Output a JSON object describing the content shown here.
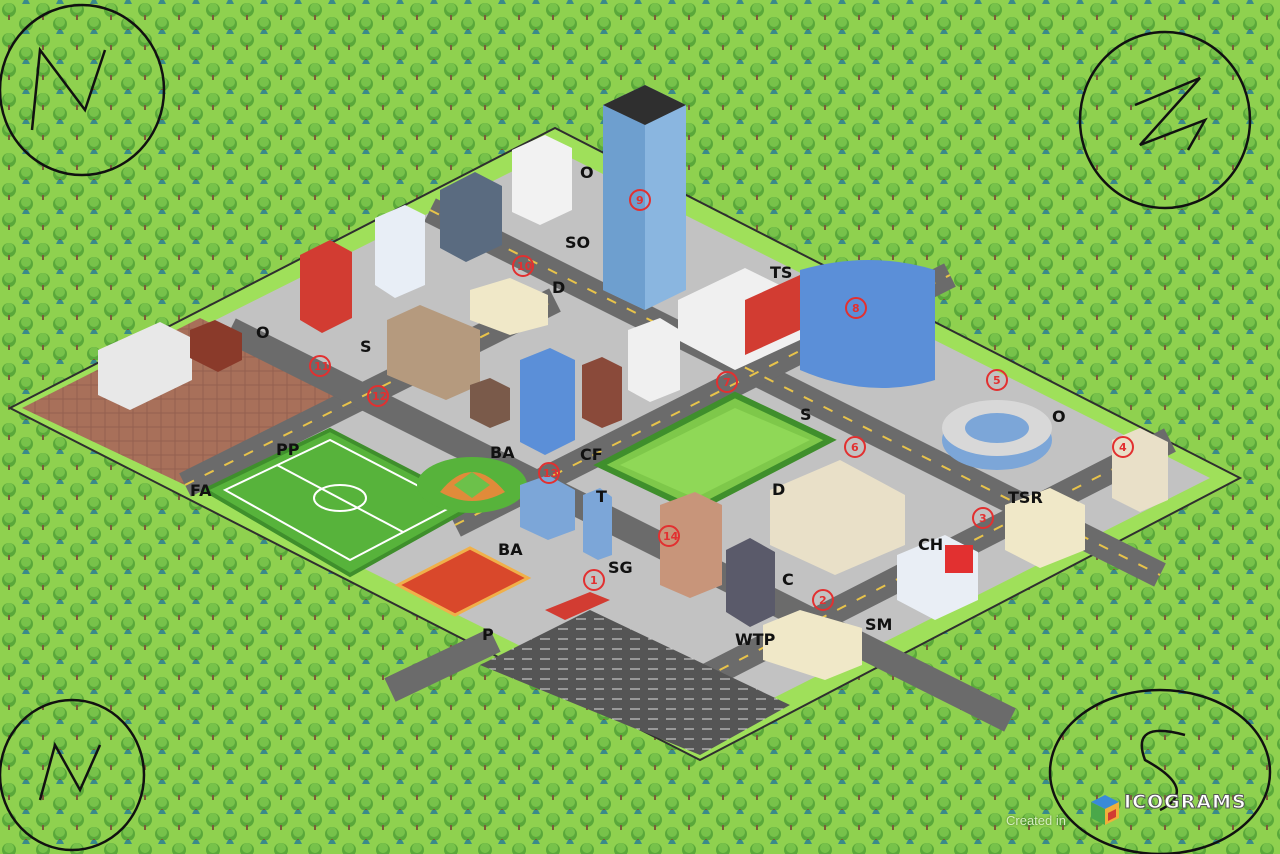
{
  "map": {
    "compass_letters": [
      "N",
      "E",
      "W",
      "S"
    ],
    "labels": [
      "O",
      "S",
      "SO",
      "O",
      "D",
      "S",
      "TS",
      "O",
      "PP",
      "FA",
      "BA",
      "CF",
      "T",
      "D",
      "BA",
      "SG",
      "P",
      "WTP",
      "C",
      "SM",
      "CH",
      "TSR",
      "O"
    ],
    "markers": [
      "1",
      "2",
      "3",
      "4",
      "5",
      "6",
      "7",
      "8",
      "9",
      "10",
      "11",
      "12",
      "13",
      "14",
      "15"
    ],
    "colors": {
      "grass": "#8fd14f",
      "forest": "#5aa83a",
      "tree_dark": "#3c8a2a",
      "pine": "#3a8a8a",
      "road": "#6b6b6b",
      "pavement": "#b9b9b9",
      "plaza": "#b07a62",
      "field": "#57b33b",
      "marker": "#e23030"
    }
  },
  "credit": {
    "created_in": "Created in",
    "brand": "ICOGRAMS"
  }
}
